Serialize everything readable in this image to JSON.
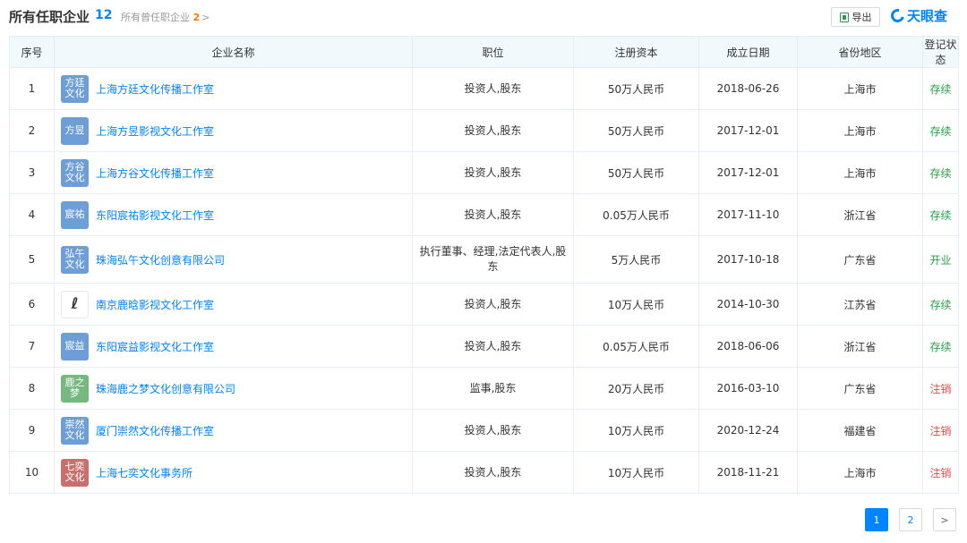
{
  "header": {
    "title": "所有任职企业",
    "count": "12",
    "former_label": "所有曾任职企业",
    "former_count": "2",
    "former_chevron": ">",
    "export_label": "导出",
    "brand": "天眼查"
  },
  "columns": [
    "序号",
    "企业名称",
    "职位",
    "注册资本",
    "成立日期",
    "省份地区",
    "登记状态"
  ],
  "rows": [
    {
      "no": "1",
      "logo_text": "方廷文化",
      "logo_color": "#6e9ed6",
      "name": "上海方廷文化传播工作室",
      "position": "投资人,股东",
      "capital": "50万人民币",
      "date": "2018-06-26",
      "region": "上海市",
      "status": "存续",
      "status_color": "#2aa146"
    },
    {
      "no": "2",
      "logo_text": "方昱",
      "logo_color": "#6e9ed6",
      "name": "上海方昱影视文化工作室",
      "position": "投资人,股东",
      "capital": "50万人民币",
      "date": "2017-12-01",
      "region": "上海市",
      "status": "存续",
      "status_color": "#2aa146"
    },
    {
      "no": "3",
      "logo_text": "方谷文化",
      "logo_color": "#6e9ed6",
      "name": "上海方谷文化传播工作室",
      "position": "投资人,股东",
      "capital": "50万人民币",
      "date": "2017-12-01",
      "region": "上海市",
      "status": "存续",
      "status_color": "#2aa146"
    },
    {
      "no": "4",
      "logo_text": "宸祐",
      "logo_color": "#6e9ed6",
      "name": "东阳宸祐影视文化工作室",
      "position": "投资人,股东",
      "capital": "0.05万人民币",
      "date": "2017-11-10",
      "region": "浙江省",
      "status": "存续",
      "status_color": "#2aa146"
    },
    {
      "no": "5",
      "logo_text": "弘午文化",
      "logo_color": "#6e9ed6",
      "name": "珠海弘午文化创意有限公司",
      "position": "执行董事、经理,法定代表人,股东",
      "capital": "5万人民币",
      "date": "2017-10-18",
      "region": "广东省",
      "status": "开业",
      "status_color": "#2aa146"
    },
    {
      "no": "6",
      "logo_text": "",
      "logo_color": "#ffffff",
      "name": "南京鹿晗影视文化工作室",
      "position": "投资人,股东",
      "capital": "10万人民币",
      "date": "2014-10-30",
      "region": "江苏省",
      "status": "存续",
      "status_color": "#2aa146"
    },
    {
      "no": "7",
      "logo_text": "宸益",
      "logo_color": "#6e9ed6",
      "name": "东阳宸益影视文化工作室",
      "position": "投资人,股东",
      "capital": "0.05万人民币",
      "date": "2018-06-06",
      "region": "浙江省",
      "status": "存续",
      "status_color": "#2aa146"
    },
    {
      "no": "8",
      "logo_text": "鹿之梦",
      "logo_color": "#76b87f",
      "name": "珠海鹿之梦文化创意有限公司",
      "position": "监事,股东",
      "capital": "20万人民币",
      "date": "2016-03-10",
      "region": "广东省",
      "status": "注销",
      "status_color": "#f04848"
    },
    {
      "no": "9",
      "logo_text": "崇然文化",
      "logo_color": "#6e9ed6",
      "name": "厦门崇然文化传播工作室",
      "position": "投资人,股东",
      "capital": "10万人民币",
      "date": "2020-12-24",
      "region": "福建省",
      "status": "注销",
      "status_color": "#f04848"
    },
    {
      "no": "10",
      "logo_text": "七奕文化",
      "logo_color": "#c9706f",
      "name": "上海七奕文化事务所",
      "position": "投资人,股东",
      "capital": "10万人民币",
      "date": "2018-11-21",
      "region": "上海市",
      "status": "注销",
      "status_color": "#f04848"
    }
  ],
  "pagination": {
    "pages": [
      "1",
      "2"
    ],
    "active": "1",
    "next_label": ">"
  }
}
